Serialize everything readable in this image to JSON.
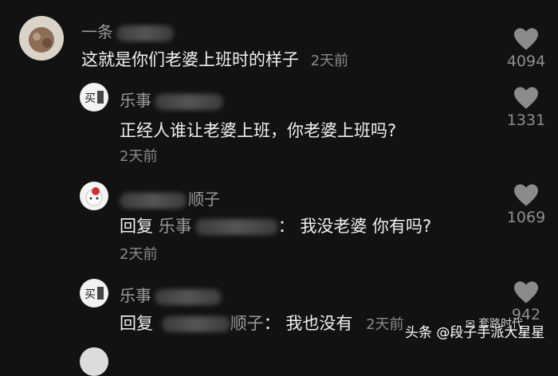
{
  "comments": [
    {
      "name": "一条",
      "text": "这就是你们老婆上班时的样子",
      "time": "2天前",
      "likes": "4094"
    },
    {
      "name": "乐事",
      "text": "正经人谁让老婆上班，你老婆上班吗?",
      "time": "2天前",
      "likes": "1331"
    },
    {
      "name": "顺子",
      "reply_word": "回复",
      "reply_to": "乐事",
      "text": "：  我没老婆 你有吗?",
      "time": "2天前",
      "likes": "1069"
    },
    {
      "name": "乐事",
      "reply_word": "回复",
      "reply_to": "顺子",
      "text": "：  我也没有",
      "time": "2天前",
      "likes": "942"
    }
  ],
  "watermark": {
    "text": "头条 @段子手派大星星",
    "logo_text": "套路时代"
  }
}
